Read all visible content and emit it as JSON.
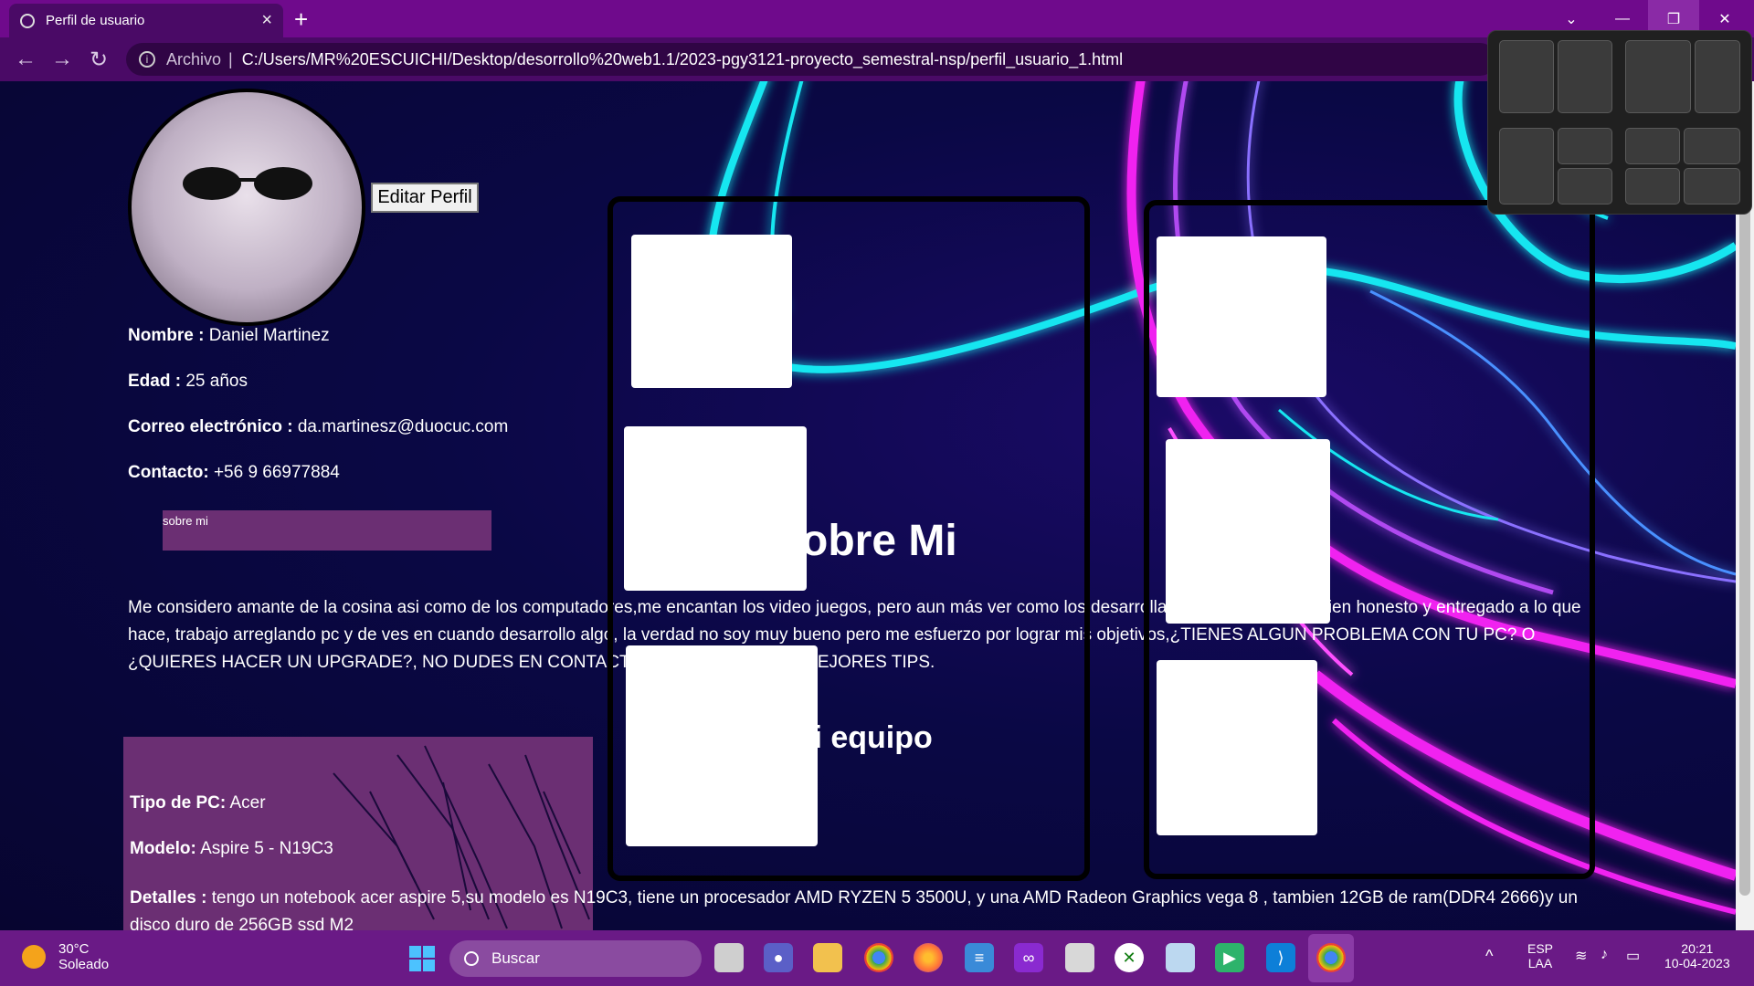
{
  "browser": {
    "tab_title": "Perfil de usuario",
    "address_scheme": "Archivo",
    "address_url": "C:/Users/MR%20ESCUICHI/Desktop/desorrollo%20web1.1/2023-pgy3121-proyecto_semestral-nsp/perfil_usuario_1.html"
  },
  "profile": {
    "edit_button": "Editar Perfil",
    "fields": [
      {
        "label": "Nombre :",
        "value": "Daniel Martinez"
      },
      {
        "label": "Edad :",
        "value": "25 años"
      },
      {
        "label": "Correo electrónico :",
        "value": "da.martinesz@duocuc.com"
      },
      {
        "label": "Contacto:",
        "value": "+56 9 66977884"
      }
    ],
    "about_tag": "sobre mi",
    "about_text": "Me considero amante de la cosina asi como de los computadores,me encantan los video juegos, pero aun más ver como los desarrollan, me considero alguien honesto y entregado a lo que hace, trabajo arreglando pc y de ves en cuando desarrollo algo, la verdad no soy muy bueno pero me esfuerzo por lograr mis objetivos,¿TIENES ALGUN PROBLEMA CON TU PC? O ¿QUIERES HACER UN UPGRADE?, NO DUDES EN CONTACTARME TE DARE LOS MEJORES TIPS.",
    "pc": [
      {
        "label": "Tipo de PC:",
        "value": "Acer"
      },
      {
        "label": "Modelo:",
        "value": "Aspire 5 - N19C3"
      },
      {
        "label": "Detalles :",
        "value": "tengo un notebook acer aspire 5,su modelo es N19C3, tiene un procesador AMD RYZEN 5 3500U, y una AMD Radeon Graphics vega 8 , tambien 12GB de ram(DDR4 2666)y un disco duro de 256GB ssd M2"
      }
    ],
    "heading_about": "obre Mi",
    "heading_team": "li equipo"
  },
  "taskbar": {
    "weather_temp": "30°C",
    "weather_desc": "Soleado",
    "search_placeholder": "Buscar",
    "lang_top": "ESP",
    "lang_bottom": "LAA",
    "time": "20:21",
    "date": "10-04-2023"
  },
  "colors": {
    "tabbar": "#6f0a8c",
    "address_bar": "#4a0a66",
    "page_bg": "#0a0845",
    "accent_box": "#6b2f73",
    "taskbar": "#6a1a86",
    "neon_cyan": "#19e6f0",
    "neon_magenta": "#f020f0"
  }
}
